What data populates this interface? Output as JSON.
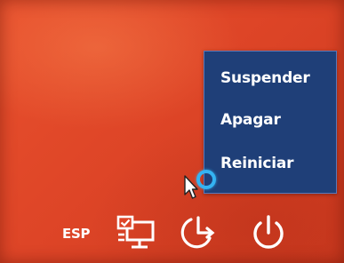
{
  "power_menu": {
    "items": [
      {
        "label": "Suspender"
      },
      {
        "label": "Apagar"
      },
      {
        "label": "Reiniciar"
      }
    ],
    "background": "#1f3f78"
  },
  "bottom_bar": {
    "language": "ESP",
    "icons": [
      "network-icon",
      "ease-of-access-icon",
      "power-icon"
    ]
  },
  "colors": {
    "background": "#de4527",
    "cursor_ring": "#34b3f2",
    "text": "#ffffff"
  }
}
